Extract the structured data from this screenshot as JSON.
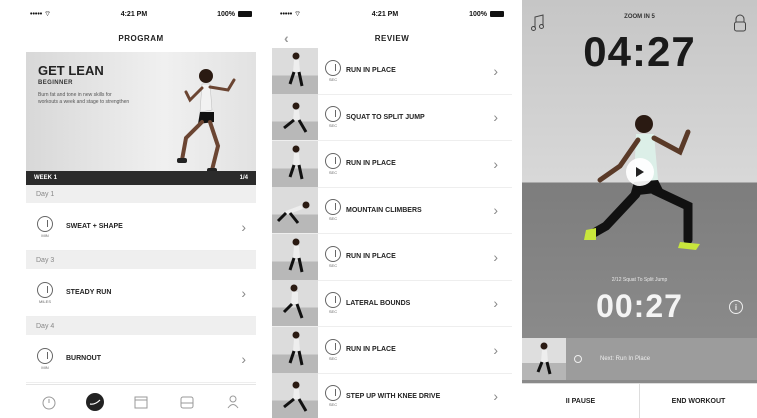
{
  "program": {
    "status": {
      "carrier": "••••• ⌔",
      "time": "4:21 PM",
      "battery": "100%"
    },
    "title": "PROGRAM",
    "hero": {
      "title": "GET LEAN",
      "level": "BEGINNER",
      "description": "Burn fat and tone in new skills for workouts a week and stage to strengthen",
      "week": "WEEK 1",
      "week_count": "1/4"
    },
    "days": [
      {
        "header": "Day 1",
        "workout": "SWEAT + SHAPE"
      },
      {
        "header": "Day 3",
        "workout": "STEADY RUN"
      },
      {
        "header": "Day 4",
        "workout": "BURNOUT"
      }
    ],
    "tabs": [
      "stopwatch-icon",
      "nike-icon",
      "calendar-icon",
      "inbox-icon",
      "profile-icon"
    ]
  },
  "review": {
    "status": {
      "carrier": "••••• ⌔",
      "time": "4:21 PM",
      "battery": "100%"
    },
    "title": "REVIEW",
    "exercises": [
      "RUN IN PLACE",
      "SQUAT TO SPLIT JUMP",
      "RUN IN PLACE",
      "MOUNTAIN CLIMBERS",
      "RUN IN PLACE",
      "LATERAL BOUNDS",
      "RUN IN PLACE",
      "STEP UP WITH KNEE DRIVE"
    ]
  },
  "workout": {
    "zoom_label": "ZOOM IN 5",
    "main_timer": "04:27",
    "current_exercise": "2/12 Squat To Split Jump",
    "exercise_timer": "00:27",
    "next_label": "Next: Run In Place",
    "pause_label": "II PAUSE",
    "end_label": "END WORKOUT",
    "accent_color": "#c8e63c"
  }
}
